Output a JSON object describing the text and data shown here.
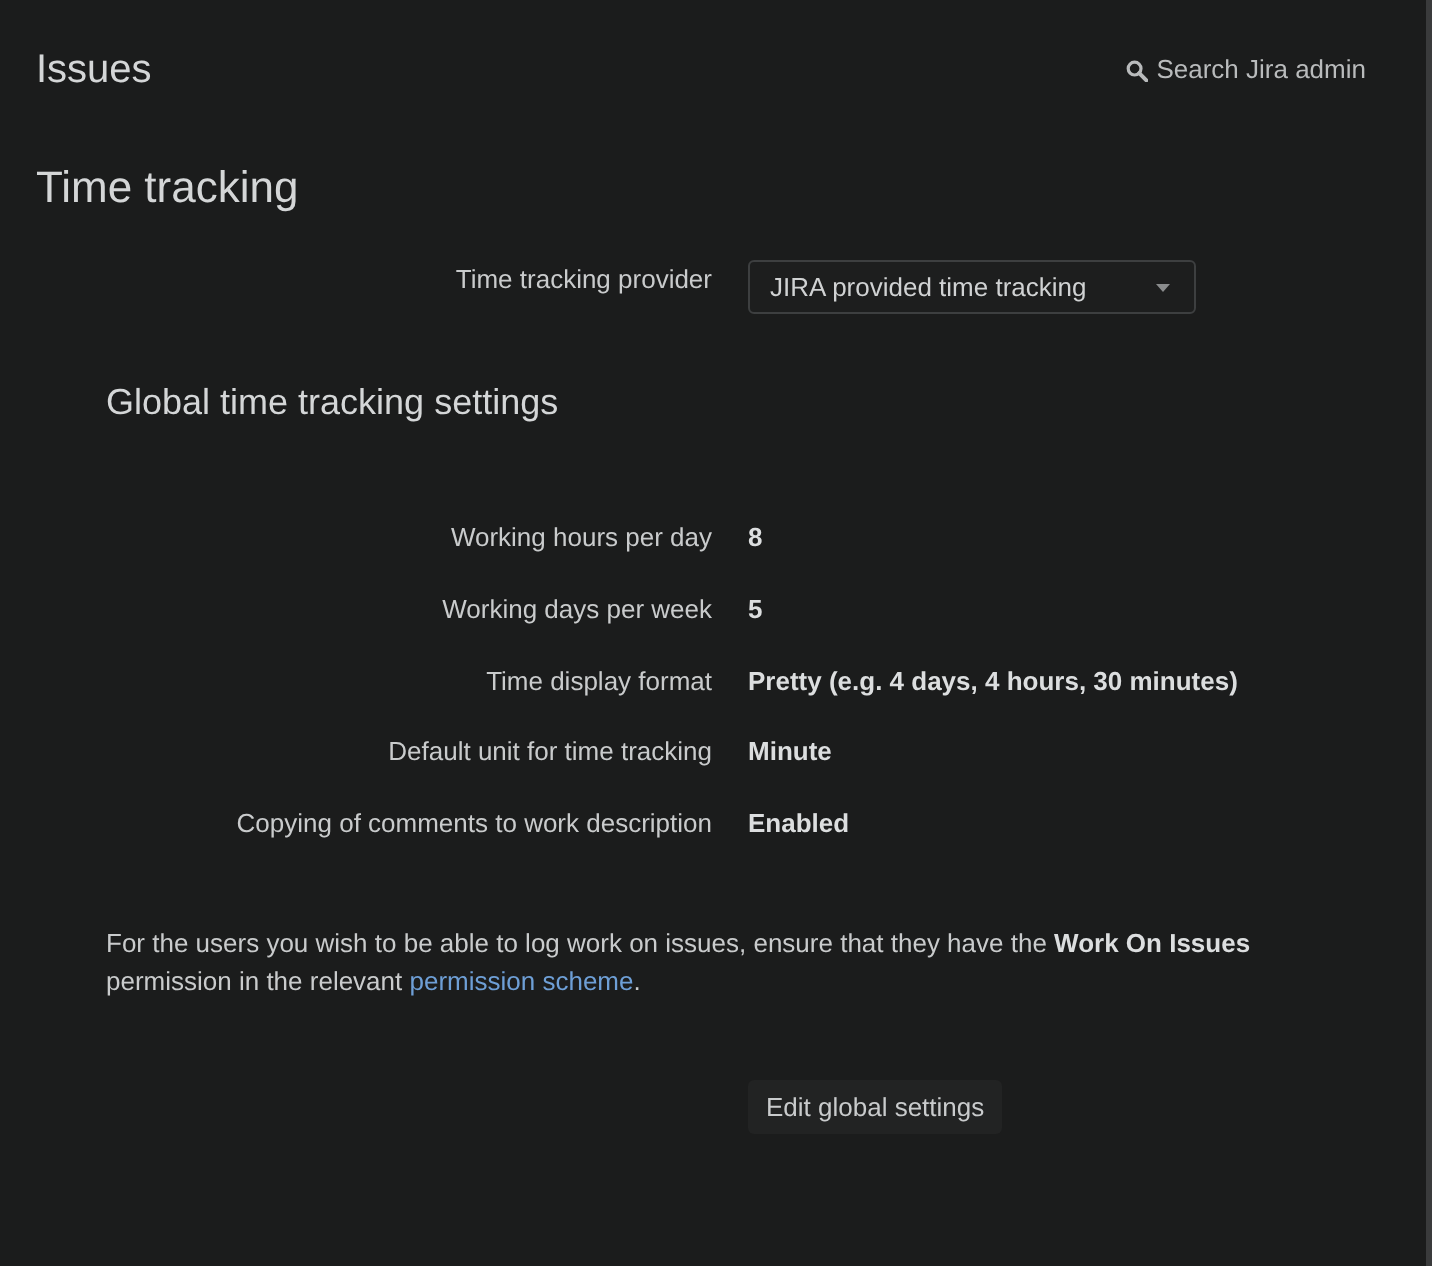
{
  "header": {
    "title": "Issues",
    "search": {
      "label": "Search Jira admin"
    }
  },
  "page_title": "Time tracking",
  "provider": {
    "label": "Time tracking provider",
    "value": "JIRA provided time tracking"
  },
  "settings": {
    "title": "Global time tracking settings",
    "rows": [
      {
        "label": "Working hours per day",
        "value": "8"
      },
      {
        "label": "Working days per week",
        "value": "5"
      },
      {
        "label": "Time display format",
        "value": "Pretty (e.g. 4 days, 4 hours, 30 minutes)"
      },
      {
        "label": "Default unit for time tracking",
        "value": "Minute"
      },
      {
        "label": "Copying of comments to work description",
        "value": "Enabled"
      }
    ]
  },
  "note": {
    "text": "For the users you wish to be able to log work on issues, ensure that they have the **Work On Issues** permission in the relevant",
    "link": "permission scheme",
    "after": "."
  },
  "buttons": [
    {
      "label": "Edit global settings"
    }
  ]
}
